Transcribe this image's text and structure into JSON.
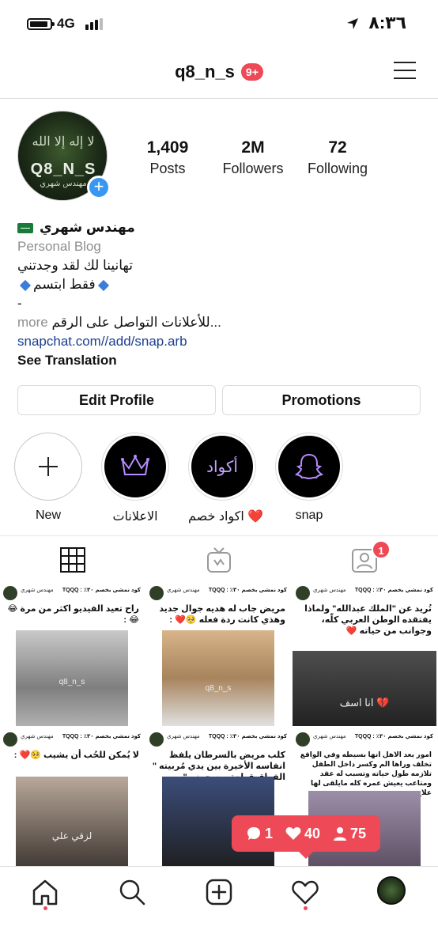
{
  "status_bar": {
    "network": "4G",
    "time": "٨:٣٦"
  },
  "header": {
    "username": "q8_n_s",
    "notifications": "9+"
  },
  "avatar": {
    "line1": "لا إله إلا الله",
    "line2": "Q8_N_S",
    "line3": "مهندس شهري"
  },
  "stats": [
    {
      "value": "1,409",
      "label": "Posts"
    },
    {
      "value": "2M",
      "label": "Followers"
    },
    {
      "value": "72",
      "label": "Following"
    }
  ],
  "bio": {
    "name": "مهندس شهري",
    "category": "Personal Blog",
    "line1": "تهانينا لك لقد وجدتني",
    "line2": "فقط ابتسم",
    "line3": "-",
    "line4": "للأعلانات التواصل على الرقم...",
    "more": "more",
    "link": "snapchat.com//add/snap.arb",
    "see_translation": "See Translation"
  },
  "buttons": {
    "edit_profile": "Edit Profile",
    "promotions": "Promotions"
  },
  "highlights": [
    {
      "label": "New"
    },
    {
      "label": "الاعلانات"
    },
    {
      "label": "اكواد خصم ❤️",
      "inner": "أكواد"
    },
    {
      "label": "snap"
    }
  ],
  "tabs": {
    "tagged_badge": "1"
  },
  "posts": [
    {
      "name": "مهندس شهري",
      "code": "كود نمشي بخصم ٣٠٪ : TQQQ",
      "caption": "راح تعيد الفيديو اكثر من مرة 😂😂 :",
      "watermark": "q8_n_s"
    },
    {
      "name": "مهندس شهري",
      "code": "كود نمشي بخصم ٣٠٪ : TQQQ",
      "caption": "مريض جاب له هديه جوال جديد وهذي كانت ردة فعله 🥺❤️ :",
      "watermark": "q8_n_s"
    },
    {
      "name": "مهندس شهري",
      "code": "كود نمشي بخصم ٣٠٪ : TQQQ",
      "caption": "تُريد عن \"الملك عبدالله\" ولماذا يفتقده الوطن العربي كلّه، وجوانب من حياته ❤️",
      "watermark": "انا اسف 💔"
    },
    {
      "name": "مهندس شهري",
      "code": "كود نمشي بخصم ٣٠٪ : TQQQ",
      "caption": "لا يُمكن للحُب أن يشيب 🥺❤️ :",
      "watermark": "لزقي علي"
    },
    {
      "name": "مهندس شهري",
      "code": "كود نمشي بخصم ٣٠٪ : TQQQ",
      "caption": "كلب مريض بالسرطان يلفظ انفاسه الأخيرة بين يدي مُربيته \" الفراق قطعة من جهنم \"",
      "watermark": ""
    },
    {
      "name": "مهندس شهري",
      "code": "كود نمشي بخصم ٣٠٪ : TQQQ",
      "caption": "امور بعد الاهل انها بسيطه وفي الواقع تخلف وراها الم وكسر داخل الطفل تلازمه طول حياته وتسبب له عقد ومتاعب يعيش عمره كله مايلقى لها علاج :",
      "watermark": ""
    }
  ],
  "activity": {
    "comments": "1",
    "likes": "40",
    "follows": "75"
  },
  "colors": {
    "accent": "#ed4956",
    "link": "#1b3f8f",
    "blue": "#3897f0"
  }
}
